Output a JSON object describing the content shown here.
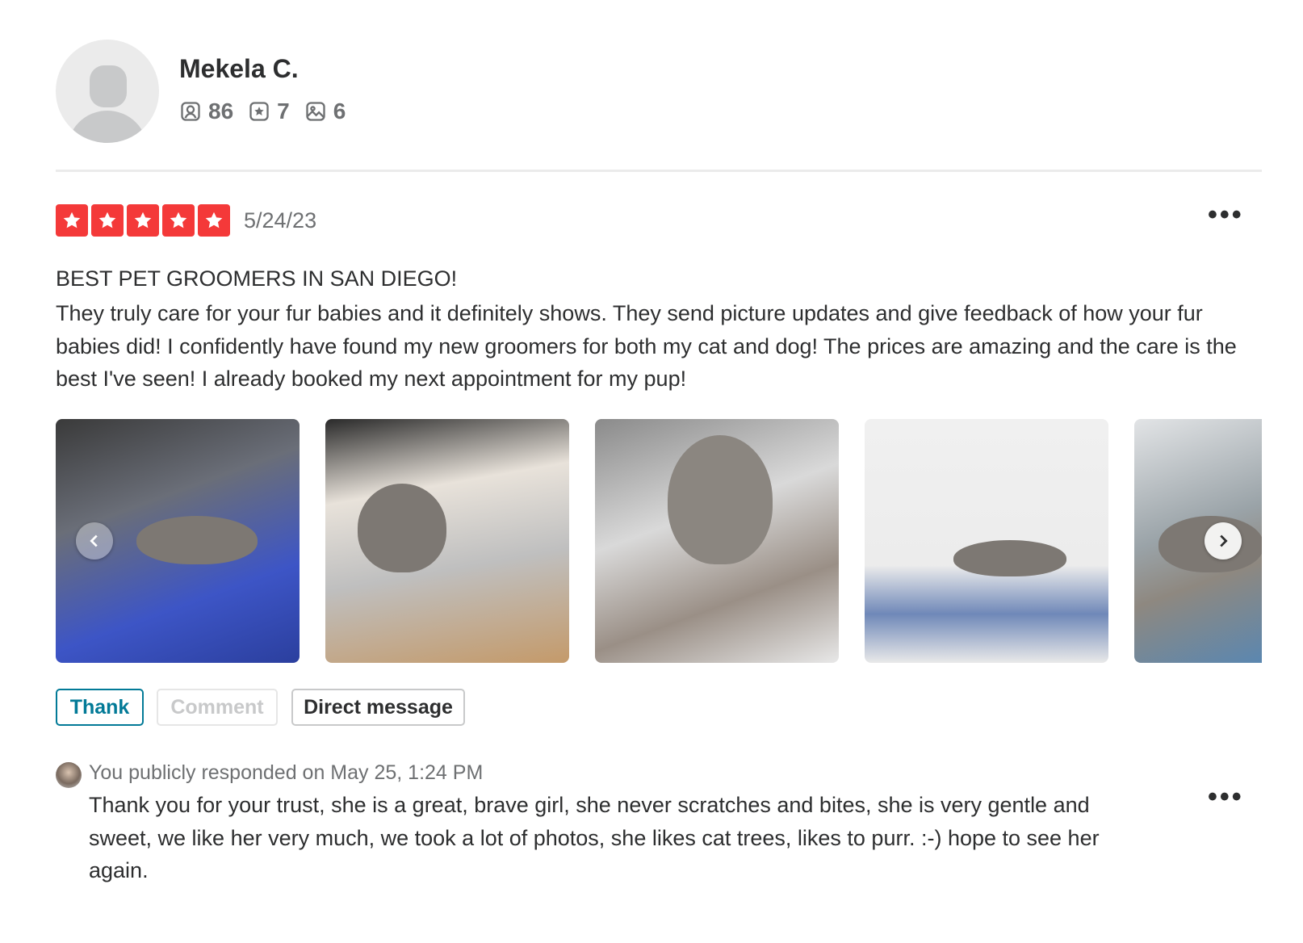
{
  "user": {
    "name": "Mekela C.",
    "friends_count": "86",
    "reviews_count": "7",
    "photos_count": "6"
  },
  "review": {
    "rating": 5,
    "date": "5/24/23",
    "title": "BEST PET GROOMERS IN SAN DIEGO!",
    "body": "They truly care for your fur babies and it definitely shows. They send picture updates and give feedback of how your fur babies did! I confidently have found my new groomers for both my cat and dog! The prices are amazing and the care is the best I've seen! I already booked my next appointment for my pup!",
    "more_label": "•••"
  },
  "actions": {
    "thank_label": "Thank",
    "comment_label": "Comment",
    "dm_label": "Direct message"
  },
  "response": {
    "meta": "You publicly responded on May 25, 1:24 PM",
    "text": "Thank you for your trust, she is a great, brave girl, she never scratches and bites, she is very gentle and sweet, we like her very much, we took a lot of photos, she likes cat trees, likes to purr. :-) hope to see her again.",
    "more_label": "•••"
  },
  "colors": {
    "star_red": "#f43939",
    "thank_teal": "#027a97",
    "muted_gray": "#6e7072"
  }
}
